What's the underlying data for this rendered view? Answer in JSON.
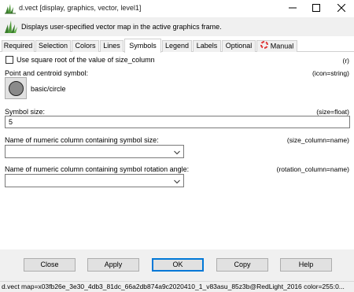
{
  "window": {
    "title": "d.vect [display, graphics, vector, level1]",
    "minimize_glyph": "—",
    "maximize_glyph": "☐",
    "close_glyph": "✕"
  },
  "description": {
    "text": "Displays user-specified vector map in the active graphics frame.",
    "icon": "grass-icon"
  },
  "tabs": [
    {
      "label": "Required",
      "active": false
    },
    {
      "label": "Selection",
      "active": false
    },
    {
      "label": "Colors",
      "active": false
    },
    {
      "label": "Lines",
      "active": false
    },
    {
      "label": "Symbols",
      "active": true
    },
    {
      "label": "Legend",
      "active": false
    },
    {
      "label": "Labels",
      "active": false
    },
    {
      "label": "Optional",
      "active": false
    },
    {
      "label": "Manual",
      "active": false,
      "icon": "lifebuoy-icon"
    }
  ],
  "symbols_panel": {
    "sqrt_checkbox": {
      "label": "Use square root of the value of size_column",
      "checked": false,
      "hint": "(r)"
    },
    "symbol": {
      "label": "Point and centroid symbol:",
      "hint": "(icon=string)",
      "value": "basic/circle"
    },
    "size": {
      "label": "Symbol size:",
      "hint": "(size=float)",
      "value": "5"
    },
    "size_column": {
      "label": "Name of numeric column containing symbol size:",
      "hint": "(size_column=name)",
      "value": ""
    },
    "rotation_column": {
      "label": "Name of numeric column containing symbol rotation angle:",
      "hint": "(rotation_column=name)",
      "value": ""
    }
  },
  "buttons": {
    "close": "Close",
    "apply": "Apply",
    "ok": "OK",
    "copy": "Copy",
    "help": "Help"
  },
  "status": {
    "command": "d.vect map=x03fb26e_3e30_4db3_81dc_66a2db874a9c2020410_1_v83asu_85z3b@RedLight_2016 color=255:0..."
  },
  "colors": {
    "accent": "#0078d7",
    "panel_bg": "#f0f0f0",
    "button_bg": "#e1e1e1"
  }
}
